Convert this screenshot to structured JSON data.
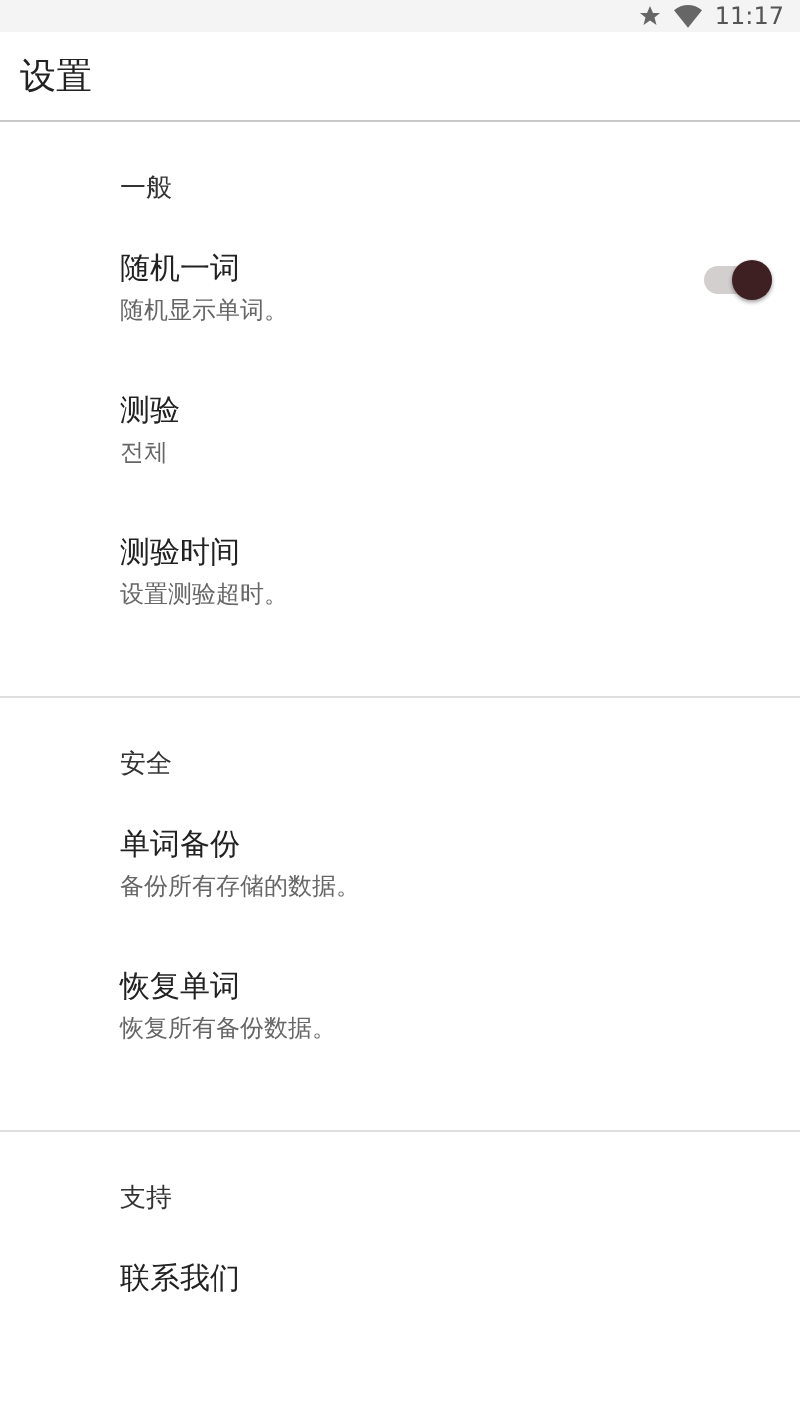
{
  "status_bar": {
    "time": "11:17"
  },
  "app_bar": {
    "title": "设置"
  },
  "sections": [
    {
      "title": "一般",
      "items": [
        {
          "kind": "switch",
          "title": "随机一词",
          "subtitle": "随机显示单词。",
          "on": true
        },
        {
          "kind": "text",
          "title": "测验",
          "subtitle": "전체"
        },
        {
          "kind": "text",
          "title": "测验时间",
          "subtitle": "设置测验超时。"
        }
      ]
    },
    {
      "title": "安全",
      "items": [
        {
          "kind": "text",
          "title": "单词备份",
          "subtitle": "备份所有存储的数据。"
        },
        {
          "kind": "text",
          "title": "恢复单词",
          "subtitle": "恢复所有备份数据。"
        }
      ]
    },
    {
      "title": "支持",
      "items": [
        {
          "kind": "text",
          "title": "联系我们"
        }
      ]
    }
  ]
}
